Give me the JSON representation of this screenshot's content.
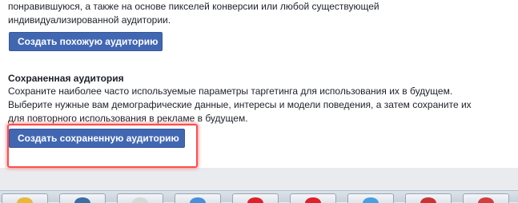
{
  "top_section": {
    "description": "понравившуюся, а также на основе пикселей конверсии или любой существующей индивидуализированной аудитории.",
    "button_label": "Создать похожую аудиторию"
  },
  "saved_audience": {
    "title": "Сохраненная аудитория",
    "description": "Сохраните наиболее часто используемые параметры таргетинга для использования их в будущем. Выберите нужные вам демографические данные, интересы и модели поведения, а затем сохраните их для повторного использования в рекламе в будущем.",
    "button_label": "Создать сохраненную аудиторию"
  },
  "colors": {
    "button_blue": "#4267b2",
    "highlight_red": "#ff4d4d",
    "text": "#1d2129"
  },
  "taskbar": {
    "items": [
      {
        "icon": "folder-icon",
        "color": "#e8b838"
      },
      {
        "icon": "app-icon",
        "color": "#3a6ea5"
      },
      {
        "icon": "browser-icon",
        "color": "#d8d8d8"
      },
      {
        "icon": "app-icon",
        "color": "#4a8fd9"
      },
      {
        "icon": "opera-icon",
        "color": "#e0202a"
      },
      {
        "icon": "opera-icon",
        "color": "#e0202a"
      },
      {
        "icon": "app-icon",
        "color": "#4a9fe0"
      },
      {
        "icon": "app-icon",
        "color": "#cc3333"
      },
      {
        "icon": "app-icon",
        "color": "#d04040"
      }
    ]
  }
}
